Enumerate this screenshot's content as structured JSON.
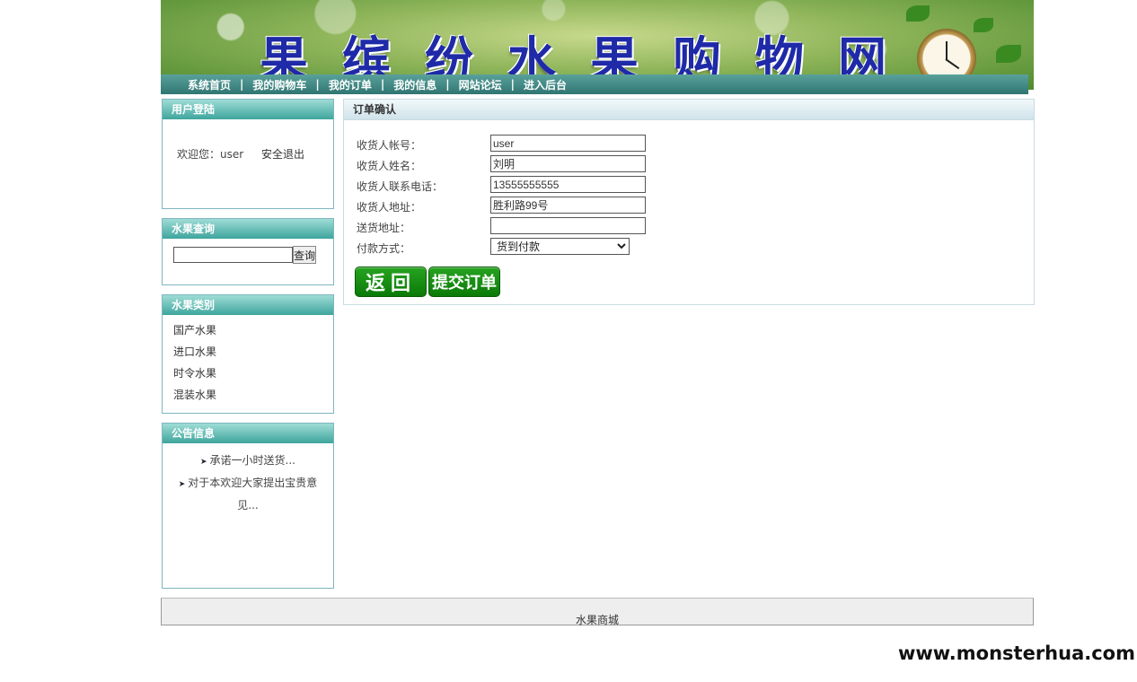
{
  "banner": {
    "title": "果缤纷水果购物网"
  },
  "nav": {
    "items": [
      {
        "label": "系统首页"
      },
      {
        "label": "我的购物车"
      },
      {
        "label": "我的订单"
      },
      {
        "label": "我的信息"
      },
      {
        "label": "网站论坛"
      },
      {
        "label": "进入后台"
      }
    ],
    "separator": "|"
  },
  "sidebar": {
    "login": {
      "title": "用户登陆",
      "welcome": "欢迎您：user",
      "logout": "安全退出"
    },
    "search": {
      "title": "水果查询",
      "input_value": "",
      "button": "查询"
    },
    "categories": {
      "title": "水果类别",
      "items": [
        "国产水果",
        "进口水果",
        "时令水果",
        "混装水果"
      ]
    },
    "notices": {
      "title": "公告信息",
      "items": [
        "承诺一小时送货...",
        "对于本欢迎大家提出宝贵意见..."
      ]
    }
  },
  "main": {
    "title": "订单确认",
    "fields": [
      {
        "label": "收货人帐号：",
        "value": "user"
      },
      {
        "label": "收货人姓名：",
        "value": "刘明"
      },
      {
        "label": "收货人联系电话：",
        "value": "13555555555"
      },
      {
        "label": "收货人地址：",
        "value": "胜利路99号"
      },
      {
        "label": "送货地址：",
        "value": ""
      }
    ],
    "payment": {
      "label": "付款方式：",
      "selected": "货到付款"
    },
    "buttons": {
      "back": "返回",
      "submit": "提交订单"
    }
  },
  "footer": {
    "text": "水果商城"
  },
  "watermark": "www.monsterhua.com"
}
